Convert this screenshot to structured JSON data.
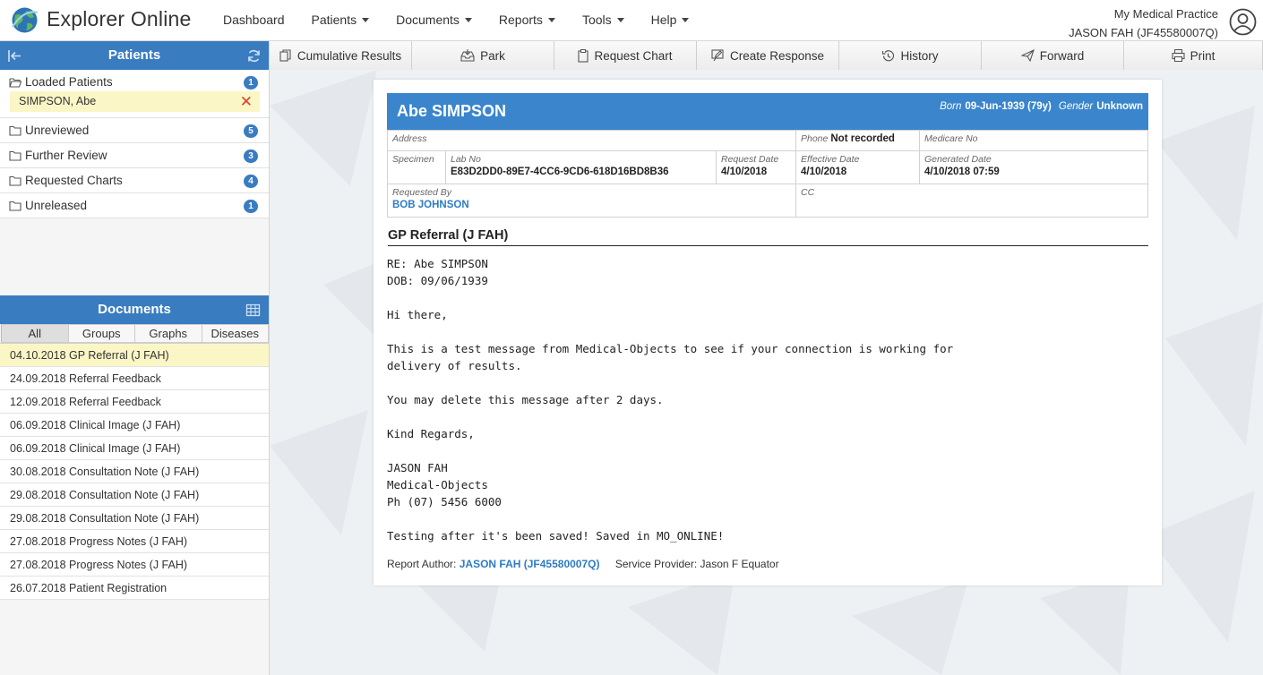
{
  "app": {
    "title": "Explorer Online"
  },
  "nav": {
    "items": [
      {
        "label": "Dashboard",
        "dropdown": false
      },
      {
        "label": "Patients",
        "dropdown": true
      },
      {
        "label": "Documents",
        "dropdown": true
      },
      {
        "label": "Reports",
        "dropdown": true
      },
      {
        "label": "Tools",
        "dropdown": true
      },
      {
        "label": "Help",
        "dropdown": true
      }
    ]
  },
  "account": {
    "practice": "My Medical Practice",
    "user": "JASON FAH (JF45580007Q)"
  },
  "patients_panel": {
    "title": "Patients",
    "loaded": {
      "label": "Loaded Patients",
      "count": "1",
      "patient": "SIMPSON, Abe"
    },
    "folders": [
      {
        "label": "Unreviewed",
        "count": "5"
      },
      {
        "label": "Further Review",
        "count": "3"
      },
      {
        "label": "Requested Charts",
        "count": "4"
      },
      {
        "label": "Unreleased",
        "count": "1"
      }
    ]
  },
  "documents_panel": {
    "title": "Documents",
    "tabs": [
      "All",
      "Groups",
      "Graphs",
      "Diseases"
    ],
    "active_tab": "All",
    "items": [
      "04.10.2018 GP Referral (J FAH)",
      "24.09.2018 Referral Feedback",
      "12.09.2018 Referral Feedback",
      "06.09.2018 Clinical Image (J FAH)",
      "06.09.2018 Clinical Image (J FAH)",
      "30.08.2018 Consultation Note (J FAH)",
      "29.08.2018 Consultation Note (J FAH)",
      "29.08.2018 Consultation Note (J FAH)",
      "27.08.2018 Progress Notes (J FAH)",
      "27.08.2018 Progress Notes (J FAH)",
      "26.07.2018 Patient Registration"
    ]
  },
  "toolbar": {
    "buttons": [
      {
        "label": "Cumulative Results",
        "icon": "copy-icon"
      },
      {
        "label": "Park",
        "icon": "inbox-icon"
      },
      {
        "label": "Request Chart",
        "icon": "clipboard-icon"
      },
      {
        "label": "Create Response",
        "icon": "edit-icon"
      },
      {
        "label": "History",
        "icon": "history-icon"
      },
      {
        "label": "Forward",
        "icon": "send-icon"
      },
      {
        "label": "Print",
        "icon": "print-icon"
      }
    ]
  },
  "report": {
    "patient_name": "Abe SIMPSON",
    "born_label": "Born",
    "born": "09-Jun-1939 (79y)",
    "gender_label": "Gender",
    "gender": "Unknown",
    "address_label": "Address",
    "phone_label": "Phone",
    "phone": "Not recorded",
    "medicare_label": "Medicare No",
    "specimen_label": "Specimen",
    "labno_label": "Lab No",
    "labno": "E83D2DD0-89E7-4CC6-9CD6-618D16BD8B36",
    "request_date_label": "Request Date",
    "request_date": "4/10/2018",
    "effective_date_label": "Effective Date",
    "effective_date": "4/10/2018",
    "generated_date_label": "Generated Date",
    "generated_date": "4/10/2018 07:59",
    "requested_by_label": "Requested By",
    "requested_by": "BOB JOHNSON",
    "cc_label": "CC",
    "section_title": "GP Referral (J FAH)",
    "body": "RE: Abe SIMPSON\nDOB: 09/06/1939\n\nHi there,\n\nThis is a test message from Medical-Objects to see if your connection is working for\ndelivery of results.\n\nYou may delete this message after 2 days.\n\nKind Regards,\n\nJASON FAH\nMedical-Objects\nPh (07) 5456 6000\n\nTesting after it's been saved! Saved in MO_ONLINE!",
    "author_label": "Report Author:",
    "author": "JASON FAH (JF45580007Q)",
    "provider_label": "Service Provider:",
    "provider": "Jason F Equator"
  },
  "colors": {
    "accent": "#3a7cc0",
    "header_blue": "#3a85cc",
    "highlight": "#fbf6c6",
    "remove": "#d9412a"
  }
}
